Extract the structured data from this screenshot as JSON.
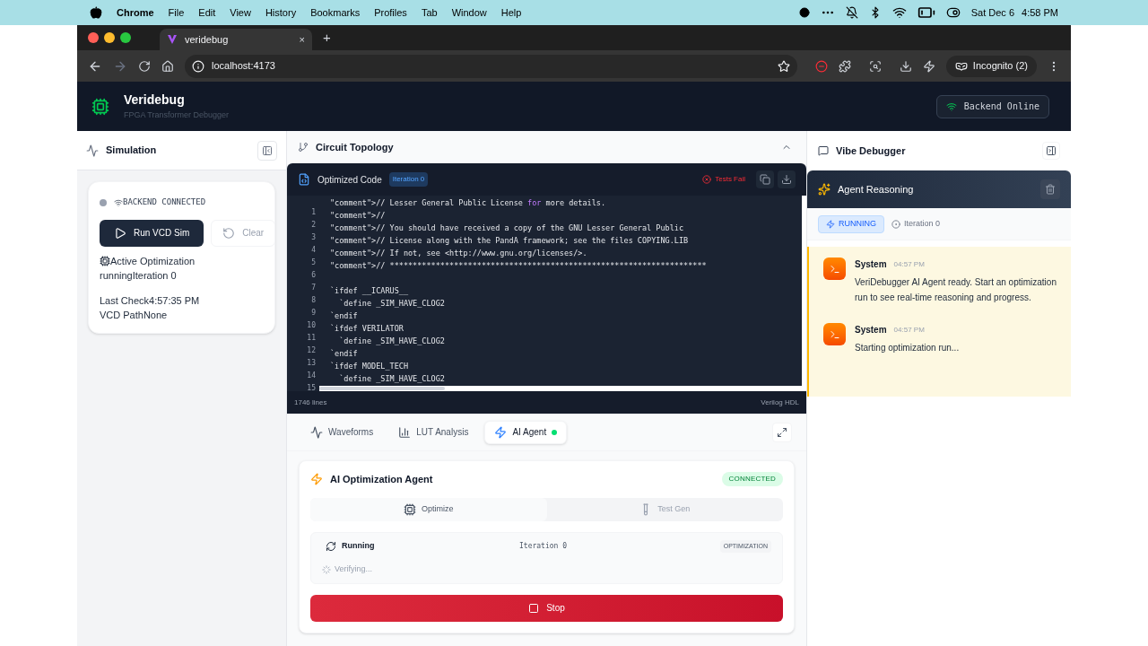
{
  "menu_bar": {
    "app": "Chrome",
    "items": [
      "File",
      "Edit",
      "View",
      "History",
      "Bookmarks",
      "Profiles",
      "Tab",
      "Window",
      "Help"
    ],
    "date": "Sat Dec 6",
    "time": "4:58 PM"
  },
  "browser": {
    "tab_title": "veridebug",
    "close": "×",
    "new_tab": "+",
    "url": "localhost:4173",
    "profile": "Incognito (2)"
  },
  "header": {
    "title": "Veridebug",
    "subtitle": "FPGA Transformer Debugger",
    "status": "Backend Online"
  },
  "simulation": {
    "title": "Simulation",
    "connection": "BACKEND CONNECTED",
    "connected": false,
    "run_button": "Run VCD Sim",
    "clear_button": "Clear",
    "clear_disabled": true,
    "stats": [
      {
        "kind": "icon",
        "text": "Active Optimization"
      },
      {
        "kind": "plain",
        "text": "runningIteration 0"
      },
      {
        "kind": "gap",
        "text": "Last Check4:57:35 PM"
      },
      {
        "kind": "plain",
        "text": "VCD PathNone"
      }
    ]
  },
  "topology": {
    "title": "Circuit Topology",
    "expanded": true
  },
  "code": {
    "title": "Optimized Code",
    "badge": "Iteration 0",
    "tests": "Tests Fail",
    "line_numbers": [
      "1",
      "2",
      "3",
      "4",
      "5",
      "6",
      "7",
      "8",
      "9",
      "10",
      "11",
      "12",
      "13",
      "14",
      "15"
    ],
    "lines": [
      {
        "parts": [
          {
            "kind": "plain",
            "text": "\"comment\">// Lesser General Public License "
          },
          {
            "kind": "keyword",
            "text": "for"
          },
          {
            "kind": "plain",
            "text": " more details."
          }
        ]
      },
      {
        "parts": [
          {
            "kind": "plain",
            "text": "\"comment\">//"
          }
        ]
      },
      {
        "parts": [
          {
            "kind": "plain",
            "text": "\"comment\">// You should have received a copy of the GNU Lesser General Public"
          }
        ]
      },
      {
        "parts": [
          {
            "kind": "plain",
            "text": "\"comment\">// License along with the PandA framework; see the files COPYING.LIB"
          }
        ]
      },
      {
        "parts": [
          {
            "kind": "plain",
            "text": "\"comment\">// If not, see <http://www.gnu.org/licenses/>."
          }
        ]
      },
      {
        "parts": [
          {
            "kind": "plain",
            "text": "\"comment\">// *********************************************************************"
          }
        ]
      },
      {
        "kind": "blank"
      },
      {
        "parts": [
          {
            "kind": "plain",
            "text": "`ifdef __ICARUS__"
          }
        ]
      },
      {
        "parts": [
          {
            "kind": "plain",
            "text": "  `define _SIM_HAVE_CLOG2"
          }
        ]
      },
      {
        "parts": [
          {
            "kind": "plain",
            "text": "`endif"
          }
        ]
      },
      {
        "parts": [
          {
            "kind": "plain",
            "text": "`ifdef VERILATOR"
          }
        ]
      },
      {
        "parts": [
          {
            "kind": "plain",
            "text": "  `define _SIM_HAVE_CLOG2"
          }
        ]
      },
      {
        "parts": [
          {
            "kind": "plain",
            "text": "`endif"
          }
        ]
      },
      {
        "parts": [
          {
            "kind": "plain",
            "text": "`ifdef MODEL_TECH"
          }
        ]
      },
      {
        "parts": [
          {
            "kind": "plain",
            "text": "  `define _SIM_HAVE_CLOG2"
          }
        ]
      }
    ],
    "line_count": "1746 lines",
    "language": "Verilog HDL"
  },
  "tabs": [
    {
      "label": "Waveforms",
      "kind": "wave",
      "selected": false,
      "live": false
    },
    {
      "label": "LUT Analysis",
      "kind": "chart",
      "selected": false,
      "live": false
    },
    {
      "label": "AI Agent",
      "kind": "bolt",
      "selected": true,
      "live": true
    }
  ],
  "agent": {
    "title": "AI Optimization Agent",
    "badge": "CONNECTED",
    "modes": [
      {
        "label": "Optimize",
        "kind": "chip",
        "selected": true
      },
      {
        "label": "Test Gen",
        "kind": "tube",
        "selected": false
      }
    ],
    "status": "Running",
    "iteration": "Iteration 0",
    "tag": "OPTIMIZATION",
    "progress": "Verifying...",
    "stop": "Stop"
  },
  "vibe": {
    "title": "Vibe Debugger",
    "reasoning_title": "Agent Reasoning",
    "state": "RUNNING",
    "iteration": "Iteration 0",
    "messages": [
      {
        "sender": "System",
        "time": "04:57 PM",
        "text": "VeriDebugger AI Agent ready. Start an optimization run to see real-time reasoning and progress."
      },
      {
        "sender": "System",
        "time": "04:57 PM",
        "text": "Starting optimization run..."
      }
    ]
  }
}
